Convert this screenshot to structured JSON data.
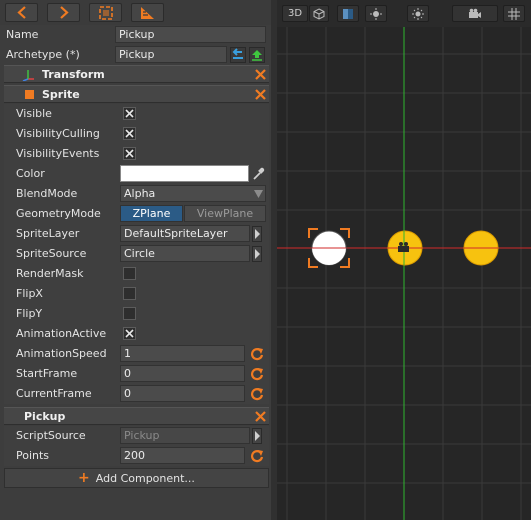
{
  "toolbar": {
    "buttons": [
      "back-icon",
      "forward-icon",
      "frame-select-icon",
      "snap-ruler-icon"
    ]
  },
  "object": {
    "name_label": "Name",
    "name_value": "Pickup",
    "archetype_label": "Archetype (*)",
    "archetype_value": "Pickup"
  },
  "components": {
    "transform": {
      "title": "Transform",
      "collapsed": true
    },
    "sprite": {
      "title": "Sprite",
      "props": {
        "visible": {
          "label": "Visible",
          "checked": true
        },
        "visibility_culling": {
          "label": "VisibilityCulling",
          "checked": true
        },
        "visibility_events": {
          "label": "VisibilityEvents",
          "checked": true
        },
        "color": {
          "label": "Color",
          "value": "#ffffff"
        },
        "blend_mode": {
          "label": "BlendMode",
          "value": "Alpha"
        },
        "geometry_mode": {
          "label": "GeometryMode",
          "options": [
            "ZPlane",
            "ViewPlane"
          ],
          "selected": "ZPlane"
        },
        "sprite_layer": {
          "label": "SpriteLayer",
          "value": "DefaultSpriteLayer"
        },
        "sprite_source": {
          "label": "SpriteSource",
          "value": "Circle"
        },
        "render_mask": {
          "label": "RenderMask",
          "checked": false
        },
        "flip_x": {
          "label": "FlipX",
          "checked": false
        },
        "flip_y": {
          "label": "FlipY",
          "checked": false
        },
        "animation_active": {
          "label": "AnimationActive",
          "checked": true
        },
        "animation_speed": {
          "label": "AnimationSpeed",
          "value": "1"
        },
        "start_frame": {
          "label": "StartFrame",
          "value": "0"
        },
        "current_frame": {
          "label": "CurrentFrame",
          "value": "0"
        }
      }
    },
    "pickup": {
      "title": "Pickup",
      "props": {
        "script_source": {
          "label": "ScriptSource",
          "value": "Pickup"
        },
        "points": {
          "label": "Points",
          "value": "200"
        }
      }
    }
  },
  "add_component_label": "Add Component...",
  "viewport": {
    "mode_label": "3D",
    "toolbar_icons": [
      "cube-icon",
      "shading-icon",
      "light-icon",
      "sun-icon",
      "camera-icon",
      "grid-icon"
    ],
    "objects": [
      {
        "name": "pickup-selected",
        "color": "#ffffff",
        "selected": true
      },
      {
        "name": "pickup-center",
        "color": "#f7c20f",
        "selected": false
      },
      {
        "name": "pickup-right",
        "color": "#f7c20f",
        "selected": false
      }
    ]
  },
  "colors": {
    "accent": "#f07b22",
    "selected_tab": "#2b5b86",
    "coin": "#f7c20f",
    "axis_x": "#d12a2a",
    "axis_y": "#2fb52f"
  }
}
